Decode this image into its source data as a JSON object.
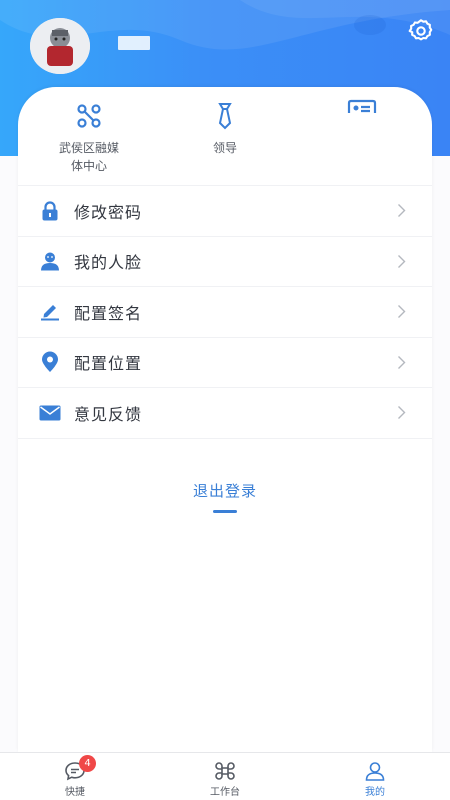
{
  "header": {
    "username": "",
    "settings_icon": "gear-icon",
    "avatar": "user-avatar"
  },
  "shortcuts": [
    {
      "label": "武侯区融媒\n体中心",
      "icon": "org-structure-icon"
    },
    {
      "label": "领导",
      "icon": "tie-icon"
    },
    {
      "label": "",
      "icon": "id-card-icon"
    }
  ],
  "menu": [
    {
      "label": "修改密码",
      "icon": "lock-icon"
    },
    {
      "label": "我的人脸",
      "icon": "face-user-icon"
    },
    {
      "label": "配置签名",
      "icon": "pen-icon"
    },
    {
      "label": "配置位置",
      "icon": "location-pin-icon"
    },
    {
      "label": "意见反馈",
      "icon": "mail-icon"
    }
  ],
  "logout_label": "退出登录",
  "bottom_nav": [
    {
      "label": "快捷",
      "icon": "chat-bubble-icon",
      "badge": "4",
      "active": false
    },
    {
      "label": "工作台",
      "icon": "command-icon",
      "active": false
    },
    {
      "label": "我的",
      "icon": "person-icon",
      "active": true
    }
  ],
  "colors": {
    "primary": "#3a7fd6",
    "header_start": "#36a7fa",
    "header_end": "#3a84f5",
    "badge": "#f04848"
  }
}
